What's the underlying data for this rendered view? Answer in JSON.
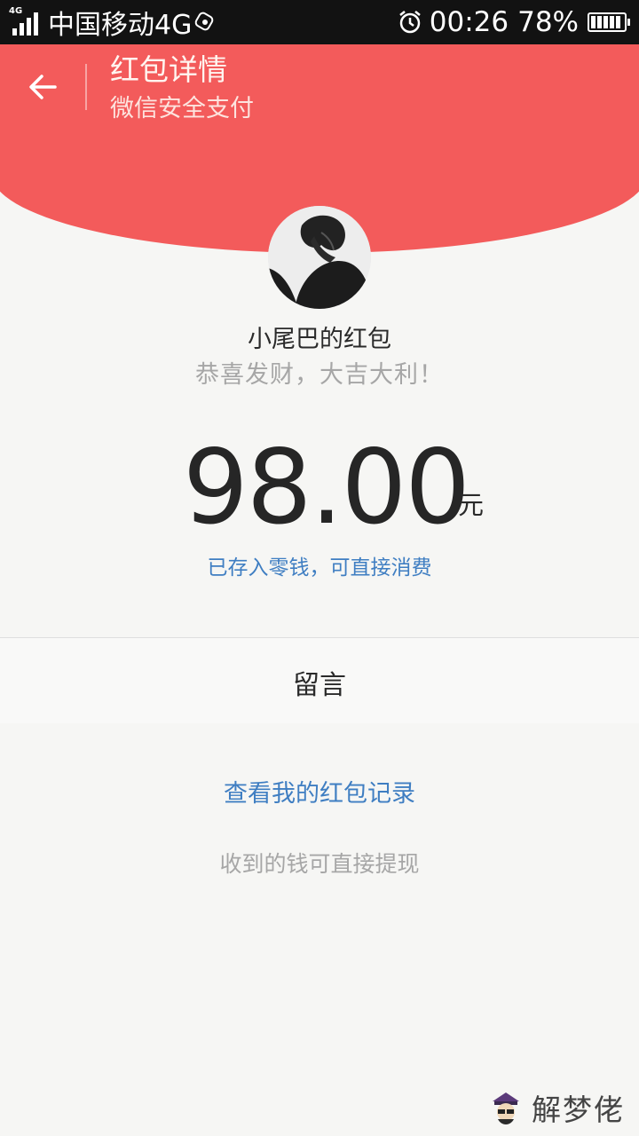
{
  "status_bar": {
    "network_type": "4G",
    "carrier": "中国移动4G",
    "time": "00:26",
    "battery_percent": "78%",
    "battery_level": 0.78
  },
  "header": {
    "title": "红包详情",
    "subtitle": "微信安全支付",
    "accent_color": "#f35b5b"
  },
  "packet": {
    "sender": "小尾巴的红包",
    "wish": "恭喜发财，大吉大利！",
    "amount": "98.00",
    "unit": "元",
    "status_link": "已存入零钱，可直接消费"
  },
  "message": {
    "label": "留言"
  },
  "footer": {
    "records_link": "查看我的红包记录",
    "withdraw_note": "收到的钱可直接提现"
  },
  "watermark": {
    "text": "解梦佬"
  },
  "colors": {
    "link": "#3f7ec2",
    "muted": "#a6a6a6"
  }
}
